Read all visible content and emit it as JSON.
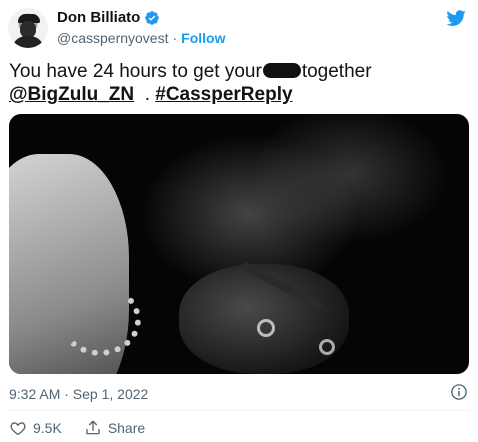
{
  "author": {
    "display_name": "Don Billiato",
    "handle": "@casspernyovest",
    "separator": "·",
    "follow_label": "Follow"
  },
  "tweet": {
    "text_before": "You have 24 hours to get your",
    "text_after": "together",
    "mention": "@BigZulu_ZN",
    "separator": ".",
    "hashtag": "#CassperReply"
  },
  "timestamp": "9:32 AM · Sep 1, 2022",
  "actions": {
    "likes_count": "9.5K",
    "share_label": "Share"
  },
  "colors": {
    "accent": "#1d9bf0",
    "text_primary": "#0f1419",
    "text_secondary": "#536471",
    "like_heart": "#536471"
  },
  "icons": [
    "verified-badge-icon",
    "twitter-bird-icon",
    "info-icon",
    "heart-icon",
    "share-icon"
  ]
}
